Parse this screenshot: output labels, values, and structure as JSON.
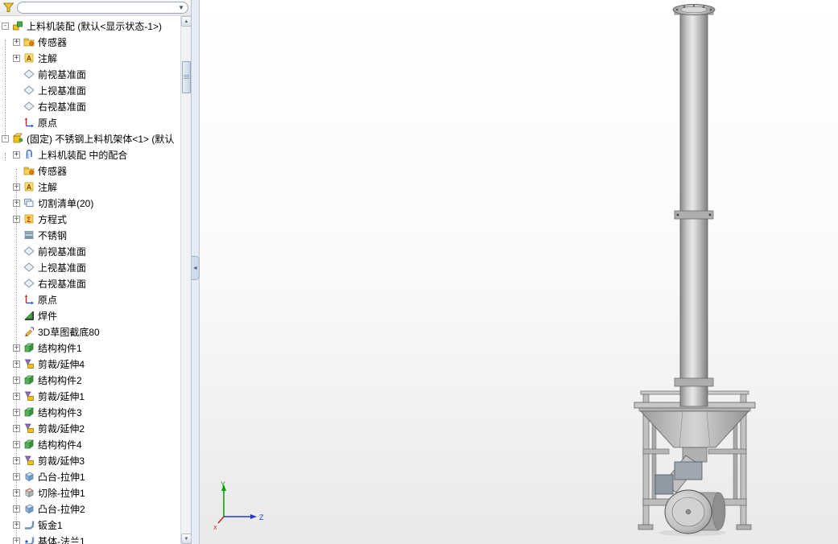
{
  "colors": {
    "panel_border": "#b6c4d4",
    "selection_accent": "#3a6fd8",
    "viewport_top": "#ffffff",
    "viewport_bottom": "#e9e9e9",
    "triad_y": "#00a000",
    "triad_z": "#2038d0",
    "triad_x": "#d02020"
  },
  "panel": {
    "toolbar": {
      "filter_icon": "funnel-icon",
      "dropdown_caret": "▼"
    },
    "scrollbar": {
      "up": "▲",
      "down": "▼"
    },
    "collapse_arrow": "◄",
    "tree": [
      {
        "label": "上料机装配 (默认<显示状态-1>)",
        "icon": "assembly",
        "level": 0,
        "expand": "minus"
      },
      {
        "label": "传感器",
        "icon": "sensor",
        "level": 1,
        "expand": "plus"
      },
      {
        "label": "注解",
        "icon": "annotation",
        "level": 1,
        "expand": "plus"
      },
      {
        "label": "前视基准面",
        "icon": "plane",
        "level": 1,
        "expand": "none"
      },
      {
        "label": "上视基准面",
        "icon": "plane",
        "level": 1,
        "expand": "none"
      },
      {
        "label": "右视基准面",
        "icon": "plane",
        "level": 1,
        "expand": "none"
      },
      {
        "label": "原点",
        "icon": "origin",
        "level": 1,
        "expand": "none"
      },
      {
        "label": "(固定) 不锈钢上料机架体<1> (默认",
        "icon": "part",
        "level": 0,
        "expand": "minus"
      },
      {
        "label": "上料机装配 中的配合",
        "icon": "mates",
        "level": 1,
        "expand": "plus"
      },
      {
        "label": "传感器",
        "icon": "sensor",
        "level": 1,
        "expand": "none"
      },
      {
        "label": "注解",
        "icon": "annotation",
        "level": 1,
        "expand": "plus"
      },
      {
        "label": "切割清单(20)",
        "icon": "cutlist",
        "level": 1,
        "expand": "plus"
      },
      {
        "label": "方程式",
        "icon": "equations",
        "level": 1,
        "expand": "plus"
      },
      {
        "label": "不锈钢",
        "icon": "material",
        "level": 1,
        "expand": "none"
      },
      {
        "label": "前视基准面",
        "icon": "plane",
        "level": 1,
        "expand": "none"
      },
      {
        "label": "上视基准面",
        "icon": "plane",
        "level": 1,
        "expand": "none"
      },
      {
        "label": "右视基准面",
        "icon": "plane",
        "level": 1,
        "expand": "none"
      },
      {
        "label": "原点",
        "icon": "origin",
        "level": 1,
        "expand": "none"
      },
      {
        "label": "焊件",
        "icon": "weldment",
        "level": 1,
        "expand": "none"
      },
      {
        "label": "3D草图截底80",
        "icon": "sketch3d",
        "level": 1,
        "expand": "none"
      },
      {
        "label": "结构构件1",
        "icon": "structural",
        "level": 1,
        "expand": "plus"
      },
      {
        "label": "剪裁/延伸4",
        "icon": "trim",
        "level": 1,
        "expand": "plus"
      },
      {
        "label": "结构构件2",
        "icon": "structural",
        "level": 1,
        "expand": "plus"
      },
      {
        "label": "剪裁/延伸1",
        "icon": "trim",
        "level": 1,
        "expand": "plus"
      },
      {
        "label": "结构构件3",
        "icon": "structural",
        "level": 1,
        "expand": "plus"
      },
      {
        "label": "剪裁/延伸2",
        "icon": "trim",
        "level": 1,
        "expand": "plus"
      },
      {
        "label": "结构构件4",
        "icon": "structural",
        "level": 1,
        "expand": "plus"
      },
      {
        "label": "剪裁/延伸3",
        "icon": "trim",
        "level": 1,
        "expand": "plus"
      },
      {
        "label": "凸台-拉伸1",
        "icon": "boss",
        "level": 1,
        "expand": "plus"
      },
      {
        "label": "切除-拉伸1",
        "icon": "cut",
        "level": 1,
        "expand": "plus"
      },
      {
        "label": "凸台-拉伸2",
        "icon": "boss",
        "level": 1,
        "expand": "plus"
      },
      {
        "label": "钣金1",
        "icon": "sheetmetal",
        "level": 1,
        "expand": "plus"
      },
      {
        "label": "基体-法兰1",
        "icon": "baseflange",
        "level": 1,
        "expand": "plus"
      }
    ]
  },
  "viewport": {
    "model_name": "screw-feeder-assembly",
    "triad": {
      "y_label": "Y",
      "z_label": "Z",
      "x_label": "X"
    }
  }
}
